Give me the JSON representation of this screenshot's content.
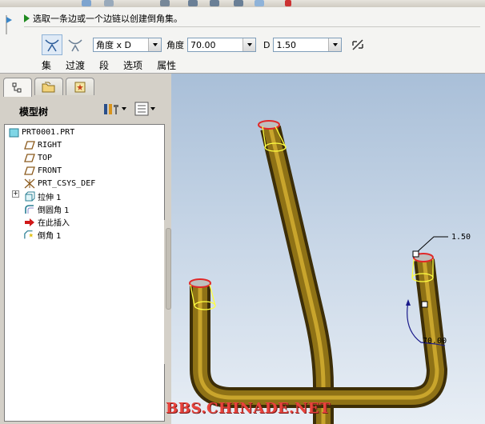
{
  "dashboard": {
    "prompt": "选取一条边或一个边链以创建倒角集。",
    "scheme_option": "角度 x D",
    "angle_label": "角度",
    "angle_value": "70.00",
    "d_label": "D",
    "d_value": "1.50",
    "tabs": [
      "集",
      "过渡",
      "段",
      "选项",
      "属性"
    ]
  },
  "model_tree": {
    "title": "模型树",
    "items": [
      {
        "label": "PRT0001.PRT",
        "icon": "part-icon"
      },
      {
        "label": "RIGHT",
        "icon": "datum-plane-icon"
      },
      {
        "label": "TOP",
        "icon": "datum-plane-icon"
      },
      {
        "label": "FRONT",
        "icon": "datum-plane-icon"
      },
      {
        "label": "PRT_CSYS_DEF",
        "icon": "csys-icon"
      },
      {
        "label": "拉伸 1",
        "icon": "extrude-icon"
      },
      {
        "label": "倒圆角 1",
        "icon": "round-icon"
      },
      {
        "label": "在此插入",
        "icon": "insert-here-icon"
      },
      {
        "label": "倒角 1",
        "icon": "chamfer-icon"
      }
    ]
  },
  "viewport": {
    "dim_d": "1.50",
    "dim_angle": "70.00"
  },
  "watermark": "BBS.CHINADE.NET",
  "colors": {
    "tube": "#6b5410",
    "highlight": "#e02828",
    "selection": "#ffff40",
    "background_top": "#a9bfd8"
  }
}
